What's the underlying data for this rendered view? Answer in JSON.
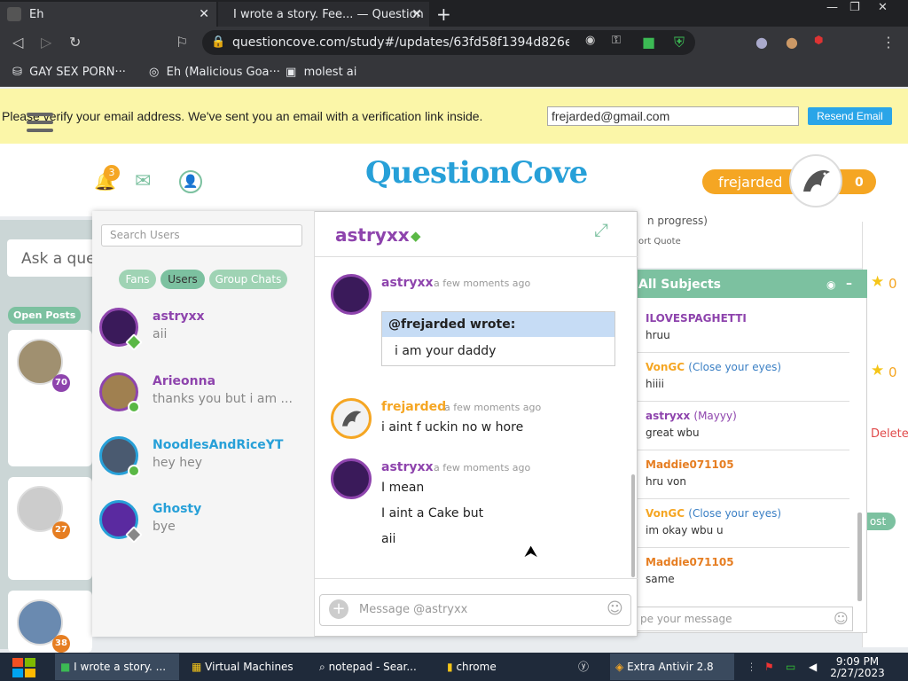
{
  "browser": {
    "tabs": [
      {
        "title": "Eh"
      },
      {
        "title": "I wrote a story. Fee... — Question"
      }
    ],
    "url": "questioncove.com/study#/updates/63fd58f1394d826ed4···",
    "bookmarks": [
      "GAY SEX PORN···",
      "Eh (Malicious Goa···",
      "molest ai"
    ]
  },
  "banner": {
    "text": "Please verify your email address. We've sent you an email with a verification link inside.",
    "email": "frejarded@gmail.com",
    "resend_label": "Resend Email"
  },
  "header": {
    "logo": "QuestionCove",
    "notification_count": "3",
    "username": "frejarded",
    "score": "0"
  },
  "background": {
    "ask_placeholder": "Ask a ques",
    "open_posts": "Open Posts",
    "in_progress": "n progress)",
    "sort_quote": "ort     Quote",
    "star_counts": [
      "0",
      "0"
    ],
    "delete": "Delete",
    "post": "ost",
    "card_badges": [
      "70",
      "27",
      "38"
    ]
  },
  "subjects": {
    "title": "All Subjects",
    "messages": [
      {
        "name": "ILOVESPAGHETTI",
        "subject": "",
        "text": "hruu",
        "color": "#8e44ad"
      },
      {
        "name": "VonGC",
        "subject": "(Close your eyes)",
        "text": "hiiii",
        "color": "#f5a623"
      },
      {
        "name": "astryxx",
        "subject": "(Mayyy)",
        "text": "great wbu",
        "color": "#8e44ad"
      },
      {
        "name": "Maddie071105",
        "subject": "",
        "text": "hru von",
        "color": "#e67e22"
      },
      {
        "name": "VonGC",
        "subject": "(Close your eyes)",
        "text": "im okay wbu u",
        "color": "#f5a623"
      },
      {
        "name": "Maddie071105",
        "subject": "",
        "text": "same",
        "color": "#e67e22"
      }
    ],
    "input_placeholder": "pe your message"
  },
  "chat": {
    "search_placeholder": "Search Users",
    "filters": [
      "Fans",
      "Users",
      "Group Chats"
    ],
    "users": [
      {
        "name": "astryxx",
        "last": "aii",
        "color": "#8e44ad",
        "status": "#5ab845"
      },
      {
        "name": "Arieonna",
        "last": "thanks you but i am ...",
        "color": "#8e44ad",
        "status": "#5ab845"
      },
      {
        "name": "NoodlesAndRiceYT",
        "last": "hey hey",
        "color": "#27a0d8",
        "status": "#5ab845"
      },
      {
        "name": "Ghosty",
        "last": "bye",
        "color": "#27a0d8",
        "status": "#888888"
      }
    ],
    "active_user": "astryxx",
    "messages": [
      {
        "author": "astryxx",
        "time": "a few moments ago",
        "quote_by": "@frejarded wrote:",
        "quote_text": "i am your daddy"
      },
      {
        "author": "frejarded",
        "time": "a few moments ago",
        "lines": [
          "i aint f uckin no w hore"
        ]
      },
      {
        "author": "astryxx",
        "time": "a few moments ago",
        "lines": [
          "I mean",
          "I aint a Cake but",
          "aii"
        ]
      }
    ],
    "message_placeholder": "Message @astryxx"
  },
  "taskbar": {
    "items": [
      "I wrote a story. ...",
      "Virtual Machines",
      "notepad - Sear...",
      "chrome",
      "Extra Antivir 2.8"
    ],
    "time": "9:09 PM",
    "date": "2/27/2023"
  }
}
